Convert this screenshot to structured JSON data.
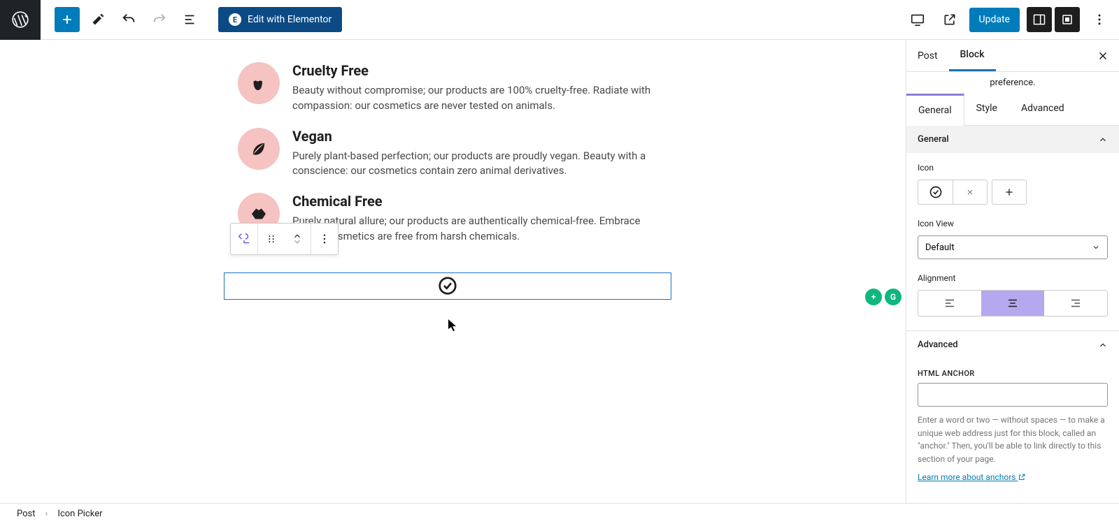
{
  "toolbar": {
    "elementor_label": "Edit with Elementor",
    "update_label": "Update"
  },
  "canvas": {
    "features": [
      {
        "title": "Cruelty Free",
        "desc": "Beauty without compromise; our products are 100% cruelty-free. Radiate with compassion: our cosmetics are never tested on animals."
      },
      {
        "title": "Vegan",
        "desc": "Purely plant-based perfection; our products are proudly vegan. Beauty with a conscience: our cosmetics contain zero animal derivatives."
      },
      {
        "title": "Chemical Free",
        "desc": "Purely natural allure; our products are authentically chemical-free. Embrace clean r cosmetics are free from harsh chemicals."
      }
    ]
  },
  "sidebar": {
    "tabs": {
      "post": "Post",
      "block": "Block"
    },
    "pref": "preference.",
    "subtabs": {
      "general": "General",
      "style": "Style",
      "advanced": "Advanced"
    },
    "sec_general": "General",
    "icon_label": "Icon",
    "icon_view_label": "Icon View",
    "icon_view_value": "Default",
    "alignment_label": "Alignment",
    "sec_advanced": "Advanced",
    "anchor_label": "HTML ANCHOR",
    "anchor_help": "Enter a word or two — without spaces — to make a unique web address just for this block, called an \"anchor.\" Then, you'll be able to link directly to this section of your page.",
    "anchor_link": "Learn more about anchors"
  },
  "breadcrumb": {
    "root": "Post",
    "current": "Icon Picker"
  }
}
